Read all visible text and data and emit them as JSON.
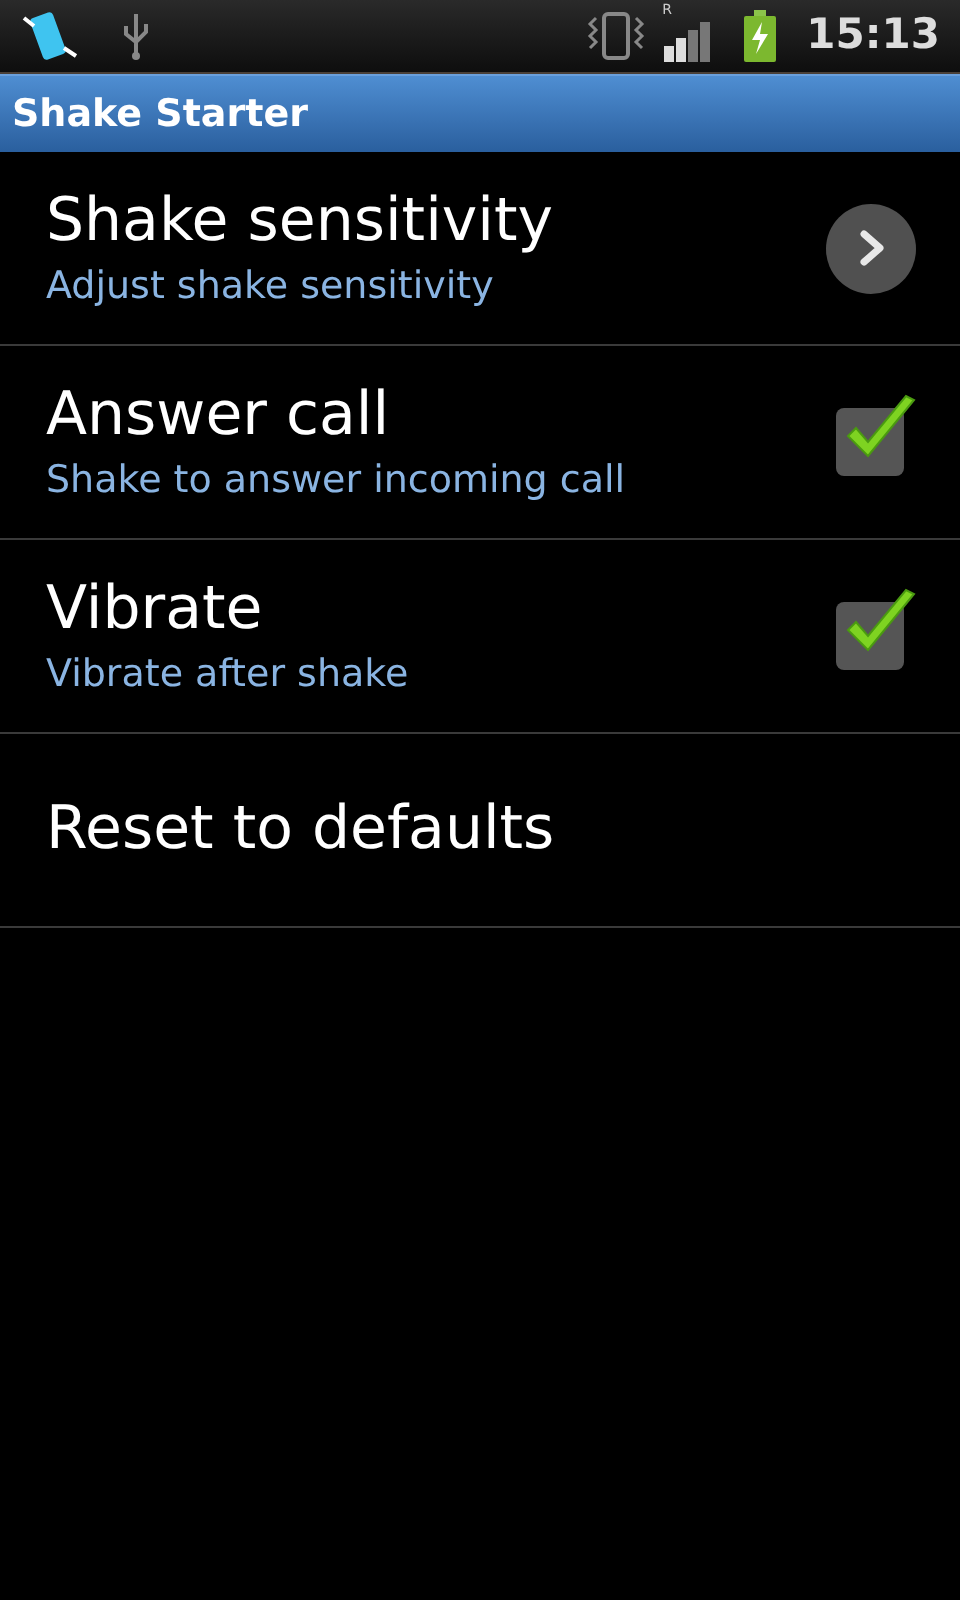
{
  "status_bar": {
    "roaming_label": "R",
    "time": "15:13"
  },
  "title_bar": {
    "title": "Shake Starter"
  },
  "preferences": [
    {
      "kind": "navigate",
      "title": "Shake sensitivity",
      "summary": "Adjust shake sensitivity"
    },
    {
      "kind": "checkbox",
      "title": "Answer call",
      "summary": "Shake to answer incoming call",
      "checked": true
    },
    {
      "kind": "checkbox",
      "title": "Vibrate",
      "summary": "Vibrate after shake",
      "checked": true
    },
    {
      "kind": "plain",
      "title": "Reset to defaults"
    }
  ]
}
